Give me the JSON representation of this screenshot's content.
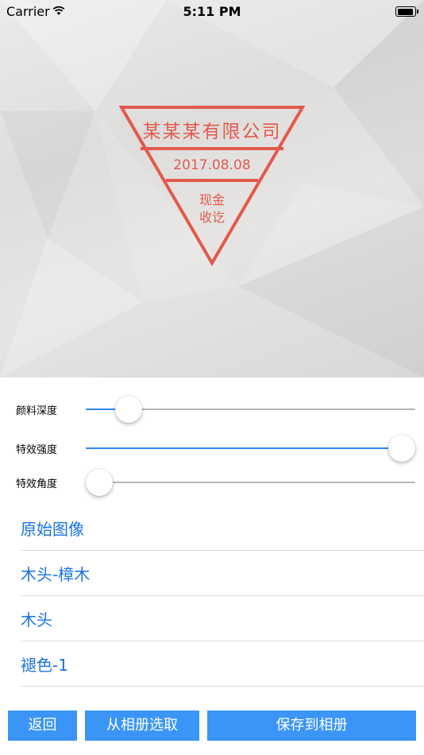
{
  "status_bar": {
    "carrier": "Carrier",
    "time": "5:11 PM",
    "battery_level": 1.0
  },
  "stamp": {
    "company": "某某某有限公司",
    "date": "2017.08.08",
    "type_line1": "现金",
    "type_line2": "收讫",
    "color": "#e25a4d"
  },
  "sliders": [
    {
      "label": "颜料深度",
      "value": 0.13
    },
    {
      "label": "特效强度",
      "value": 0.96
    },
    {
      "label": "特效角度",
      "value": 0.04
    }
  ],
  "filters": [
    {
      "label": "原始图像"
    },
    {
      "label": "木头-樟木"
    },
    {
      "label": "木头"
    },
    {
      "label": "褪色-1"
    }
  ],
  "buttons": {
    "back": "返回",
    "choose_from_album": "从相册选取",
    "save_to_album": "保存到相册"
  },
  "colors": {
    "accent": "#2f86f2",
    "button_bg": "#3a95f7",
    "list_text": "#1a73e3"
  },
  "icons": [
    "wifi-icon",
    "battery-icon"
  ]
}
